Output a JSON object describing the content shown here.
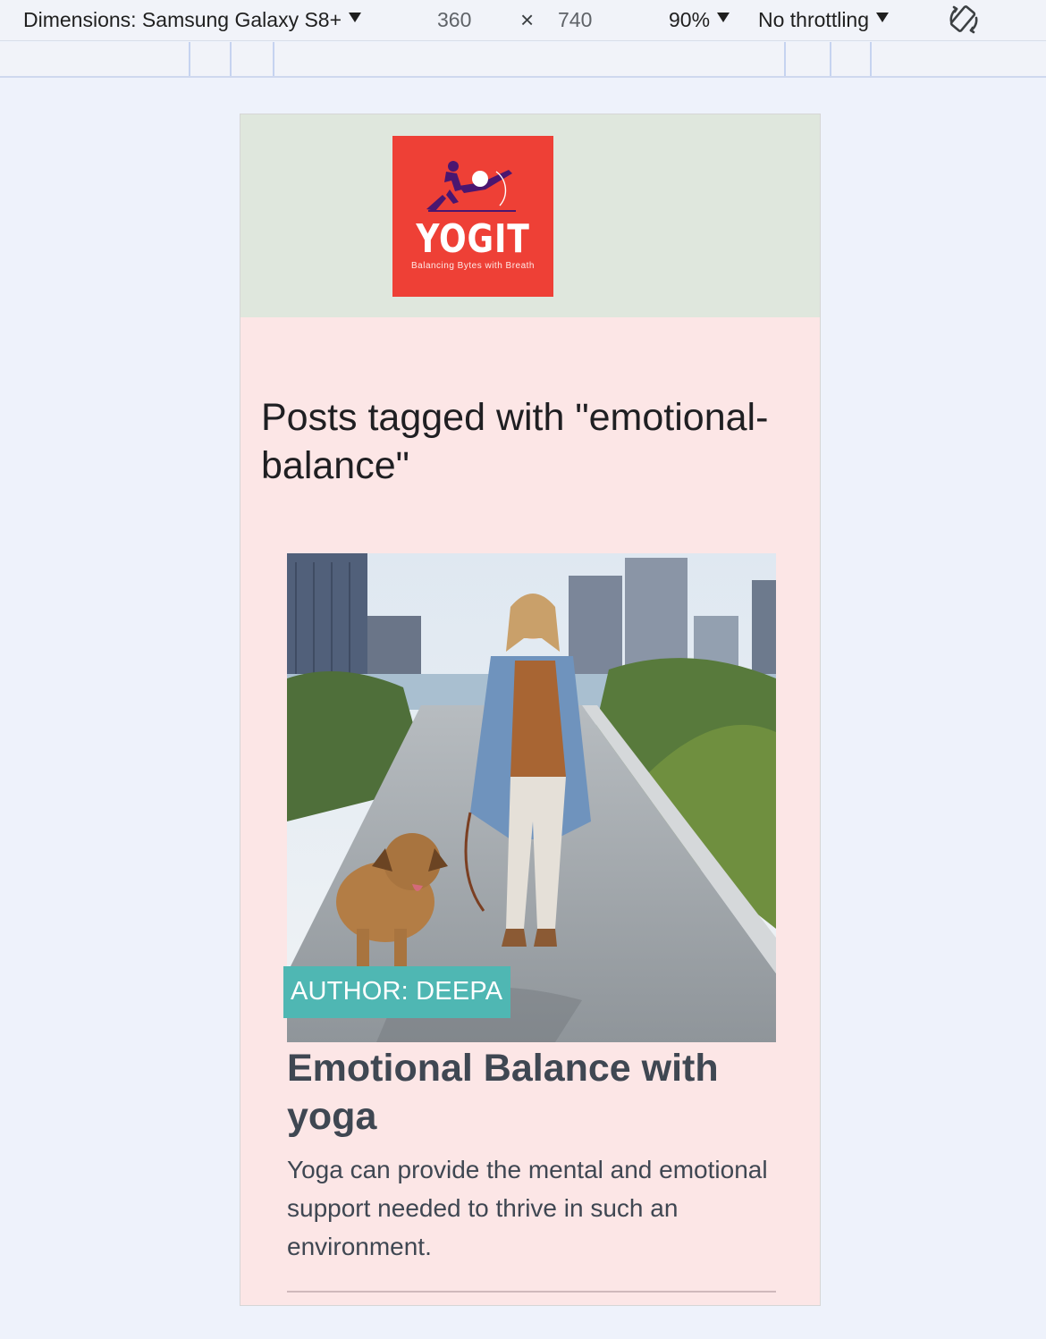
{
  "devtools": {
    "dimensions_label": "Dimensions: Samsung Galaxy S8+",
    "width": "360",
    "times": "×",
    "height": "740",
    "zoom": "90%",
    "throttling": "No throttling"
  },
  "site": {
    "logo_word": "YOGIT",
    "logo_tagline": "Balancing Bytes with Breath",
    "colors": {
      "header_bg": "#dfe7dd",
      "page_bg": "#fce6e6",
      "logo_bg": "#ee4036",
      "badge_bg": "#4fb7b3"
    }
  },
  "page": {
    "title": "Posts tagged with \"emotional-balance\""
  },
  "posts": [
    {
      "author_badge": "AUTHOR: DEEPA",
      "title": "Emotional Balance with yoga",
      "excerpt": "Yoga can provide the mental and emotional support needed to thrive in such an environment."
    }
  ]
}
